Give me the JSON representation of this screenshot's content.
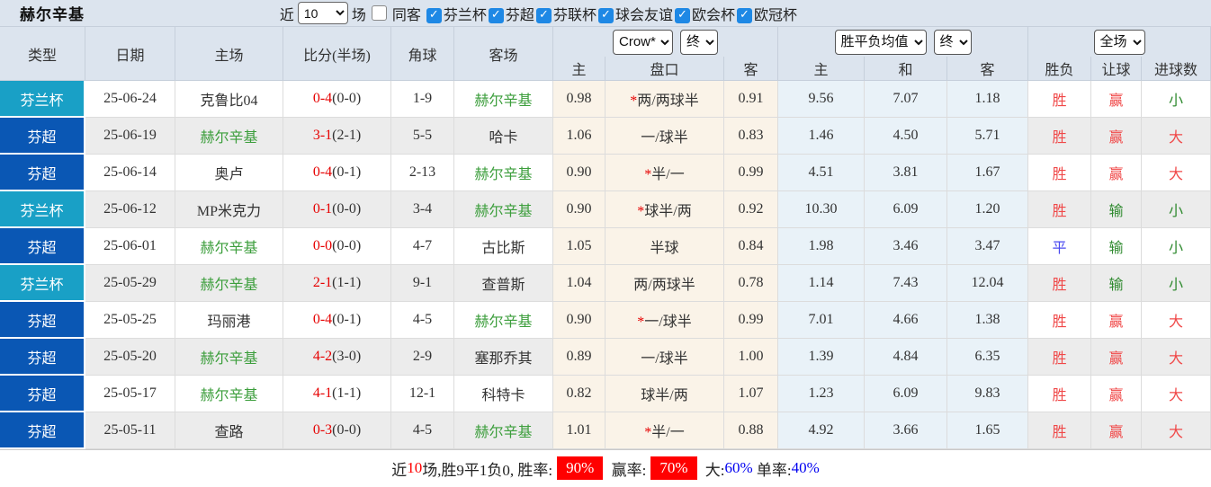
{
  "title": "赫尔辛基",
  "filters": {
    "recent_label": "近",
    "recent_value": "10",
    "games_label": "场",
    "same_venue": {
      "label": "同客",
      "checked": false
    },
    "competitions": [
      {
        "label": "芬兰杯",
        "checked": true
      },
      {
        "label": "芬超",
        "checked": true
      },
      {
        "label": "芬联杯",
        "checked": true
      },
      {
        "label": "球会友谊",
        "checked": true
      },
      {
        "label": "欧会杯",
        "checked": true
      },
      {
        "label": "欧冠杯",
        "checked": true
      }
    ]
  },
  "table": {
    "columns": [
      "类型",
      "日期",
      "主场",
      "比分(半场)",
      "角球",
      "客场"
    ],
    "odds_group": {
      "provider": "Crow*",
      "stage": "终"
    },
    "europe_group": {
      "provider": "胜平负均值",
      "stage": "终"
    },
    "result_group": {
      "scope": "全场"
    },
    "sub_columns": [
      "主",
      "盘口",
      "客",
      "主",
      "和",
      "客",
      "胜负",
      "让球",
      "进球数"
    ],
    "rows": [
      {
        "league": "芬兰杯",
        "league_color": "cup",
        "date": "25-06-24",
        "home": "克鲁比04",
        "home_highlight": false,
        "score": "0-4",
        "half": "(0-0)",
        "corners": "1-9",
        "away": "赫尔辛基",
        "away_highlight": true,
        "home_odds": "0.98",
        "handicap_star": "*",
        "handicap": "两/两球半",
        "away_odds": "0.91",
        "win": "9.56",
        "draw": "7.07",
        "lose": "1.18",
        "outcome": "胜",
        "outcome_color": "red",
        "let_goal": "赢",
        "let_goal_color": "red",
        "goals": "小",
        "goals_color": "green"
      },
      {
        "league": "芬超",
        "league_color": "league",
        "date": "25-06-19",
        "home": "赫尔辛基",
        "home_highlight": true,
        "score": "3-1",
        "half": "(2-1)",
        "corners": "5-5",
        "away": "哈卡",
        "away_highlight": false,
        "home_odds": "1.06",
        "handicap_star": "",
        "handicap": "一/球半",
        "away_odds": "0.83",
        "win": "1.46",
        "draw": "4.50",
        "lose": "5.71",
        "outcome": "胜",
        "outcome_color": "red",
        "let_goal": "赢",
        "let_goal_color": "red",
        "goals": "大",
        "goals_color": "red"
      },
      {
        "league": "芬超",
        "league_color": "league",
        "date": "25-06-14",
        "home": "奥卢",
        "home_highlight": false,
        "score": "0-4",
        "half": "(0-1)",
        "corners": "2-13",
        "away": "赫尔辛基",
        "away_highlight": true,
        "home_odds": "0.90",
        "handicap_star": "*",
        "handicap": "半/一",
        "away_odds": "0.99",
        "win": "4.51",
        "draw": "3.81",
        "lose": "1.67",
        "outcome": "胜",
        "outcome_color": "red",
        "let_goal": "赢",
        "let_goal_color": "red",
        "goals": "大",
        "goals_color": "red"
      },
      {
        "league": "芬兰杯",
        "league_color": "cup",
        "date": "25-06-12",
        "home": "MP米克力",
        "home_highlight": false,
        "score": "0-1",
        "half": "(0-0)",
        "corners": "3-4",
        "away": "赫尔辛基",
        "away_highlight": true,
        "home_odds": "0.90",
        "handicap_star": "*",
        "handicap": "球半/两",
        "away_odds": "0.92",
        "win": "10.30",
        "draw": "6.09",
        "lose": "1.20",
        "outcome": "胜",
        "outcome_color": "red",
        "let_goal": "输",
        "let_goal_color": "green",
        "goals": "小",
        "goals_color": "green"
      },
      {
        "league": "芬超",
        "league_color": "league",
        "date": "25-06-01",
        "home": "赫尔辛基",
        "home_highlight": true,
        "score": "0-0",
        "half": "(0-0)",
        "corners": "4-7",
        "away": "古比斯",
        "away_highlight": false,
        "home_odds": "1.05",
        "handicap_star": "",
        "handicap": "半球",
        "away_odds": "0.84",
        "win": "1.98",
        "draw": "3.46",
        "lose": "3.47",
        "outcome": "平",
        "outcome_color": "blue",
        "let_goal": "输",
        "let_goal_color": "green",
        "goals": "小",
        "goals_color": "green"
      },
      {
        "league": "芬兰杯",
        "league_color": "cup",
        "date": "25-05-29",
        "home": "赫尔辛基",
        "home_highlight": true,
        "score": "2-1",
        "half": "(1-1)",
        "corners": "9-1",
        "away": "查普斯",
        "away_highlight": false,
        "home_odds": "1.04",
        "handicap_star": "",
        "handicap": "两/两球半",
        "away_odds": "0.78",
        "win": "1.14",
        "draw": "7.43",
        "lose": "12.04",
        "outcome": "胜",
        "outcome_color": "red",
        "let_goal": "输",
        "let_goal_color": "green",
        "goals": "小",
        "goals_color": "green"
      },
      {
        "league": "芬超",
        "league_color": "league",
        "date": "25-05-25",
        "home": "玛丽港",
        "home_highlight": false,
        "score": "0-4",
        "half": "(0-1)",
        "corners": "4-5",
        "away": "赫尔辛基",
        "away_highlight": true,
        "home_odds": "0.90",
        "handicap_star": "*",
        "handicap": "一/球半",
        "away_odds": "0.99",
        "win": "7.01",
        "draw": "4.66",
        "lose": "1.38",
        "outcome": "胜",
        "outcome_color": "red",
        "let_goal": "赢",
        "let_goal_color": "red",
        "goals": "大",
        "goals_color": "red"
      },
      {
        "league": "芬超",
        "league_color": "league",
        "date": "25-05-20",
        "home": "赫尔辛基",
        "home_highlight": true,
        "score": "4-2",
        "half": "(3-0)",
        "corners": "2-9",
        "away": "塞那乔其",
        "away_highlight": false,
        "home_odds": "0.89",
        "handicap_star": "",
        "handicap": "一/球半",
        "away_odds": "1.00",
        "win": "1.39",
        "draw": "4.84",
        "lose": "6.35",
        "outcome": "胜",
        "outcome_color": "red",
        "let_goal": "赢",
        "let_goal_color": "red",
        "goals": "大",
        "goals_color": "red"
      },
      {
        "league": "芬超",
        "league_color": "league",
        "date": "25-05-17",
        "home": "赫尔辛基",
        "home_highlight": true,
        "score": "4-1",
        "half": "(1-1)",
        "corners": "12-1",
        "away": "科特卡",
        "away_highlight": false,
        "home_odds": "0.82",
        "handicap_star": "",
        "handicap": "球半/两",
        "away_odds": "1.07",
        "win": "1.23",
        "draw": "6.09",
        "lose": "9.83",
        "outcome": "胜",
        "outcome_color": "red",
        "let_goal": "赢",
        "let_goal_color": "red",
        "goals": "大",
        "goals_color": "red"
      },
      {
        "league": "芬超",
        "league_color": "league",
        "date": "25-05-11",
        "home": "查路",
        "home_highlight": false,
        "score": "0-3",
        "half": "(0-0)",
        "corners": "4-5",
        "away": "赫尔辛基",
        "away_highlight": true,
        "home_odds": "1.01",
        "handicap_star": "*",
        "handicap": "半/一",
        "away_odds": "0.88",
        "win": "4.92",
        "draw": "3.66",
        "lose": "1.65",
        "outcome": "胜",
        "outcome_color": "red",
        "let_goal": "赢",
        "let_goal_color": "red",
        "goals": "大",
        "goals_color": "red"
      }
    ]
  },
  "summary": {
    "parts": [
      {
        "text": "近",
        "style": "plain"
      },
      {
        "text": "10",
        "style": "red-text"
      },
      {
        "text": "场,胜9平1负0, 胜率:",
        "style": "plain"
      },
      {
        "text": "90%",
        "style": "red-badge"
      },
      {
        "text": " 赢率:",
        "style": "plain"
      },
      {
        "text": "70%",
        "style": "red-badge"
      },
      {
        "text": " 大:",
        "style": "plain"
      },
      {
        "text": "60%",
        "style": "blue-text"
      },
      {
        "text": " 单率:",
        "style": "plain"
      },
      {
        "text": "40%",
        "style": "blue-text"
      }
    ]
  },
  "colors": {
    "cup": "#19a0c6",
    "league": "#0a57b4",
    "team": "#3c9e3c",
    "score": "#e60000",
    "rred": "#f04848",
    "rgreen": "#2f8a2f",
    "rblue": "#4a4af0",
    "badge": "#ff0000",
    "linkblue": "#0000f0",
    "cbblue": "#1e88e5",
    "panel-bg": "#dce4ee",
    "row-alt": "#ececec",
    "cream": "#faf3e8",
    "lblue": "#e9f2f8"
  }
}
